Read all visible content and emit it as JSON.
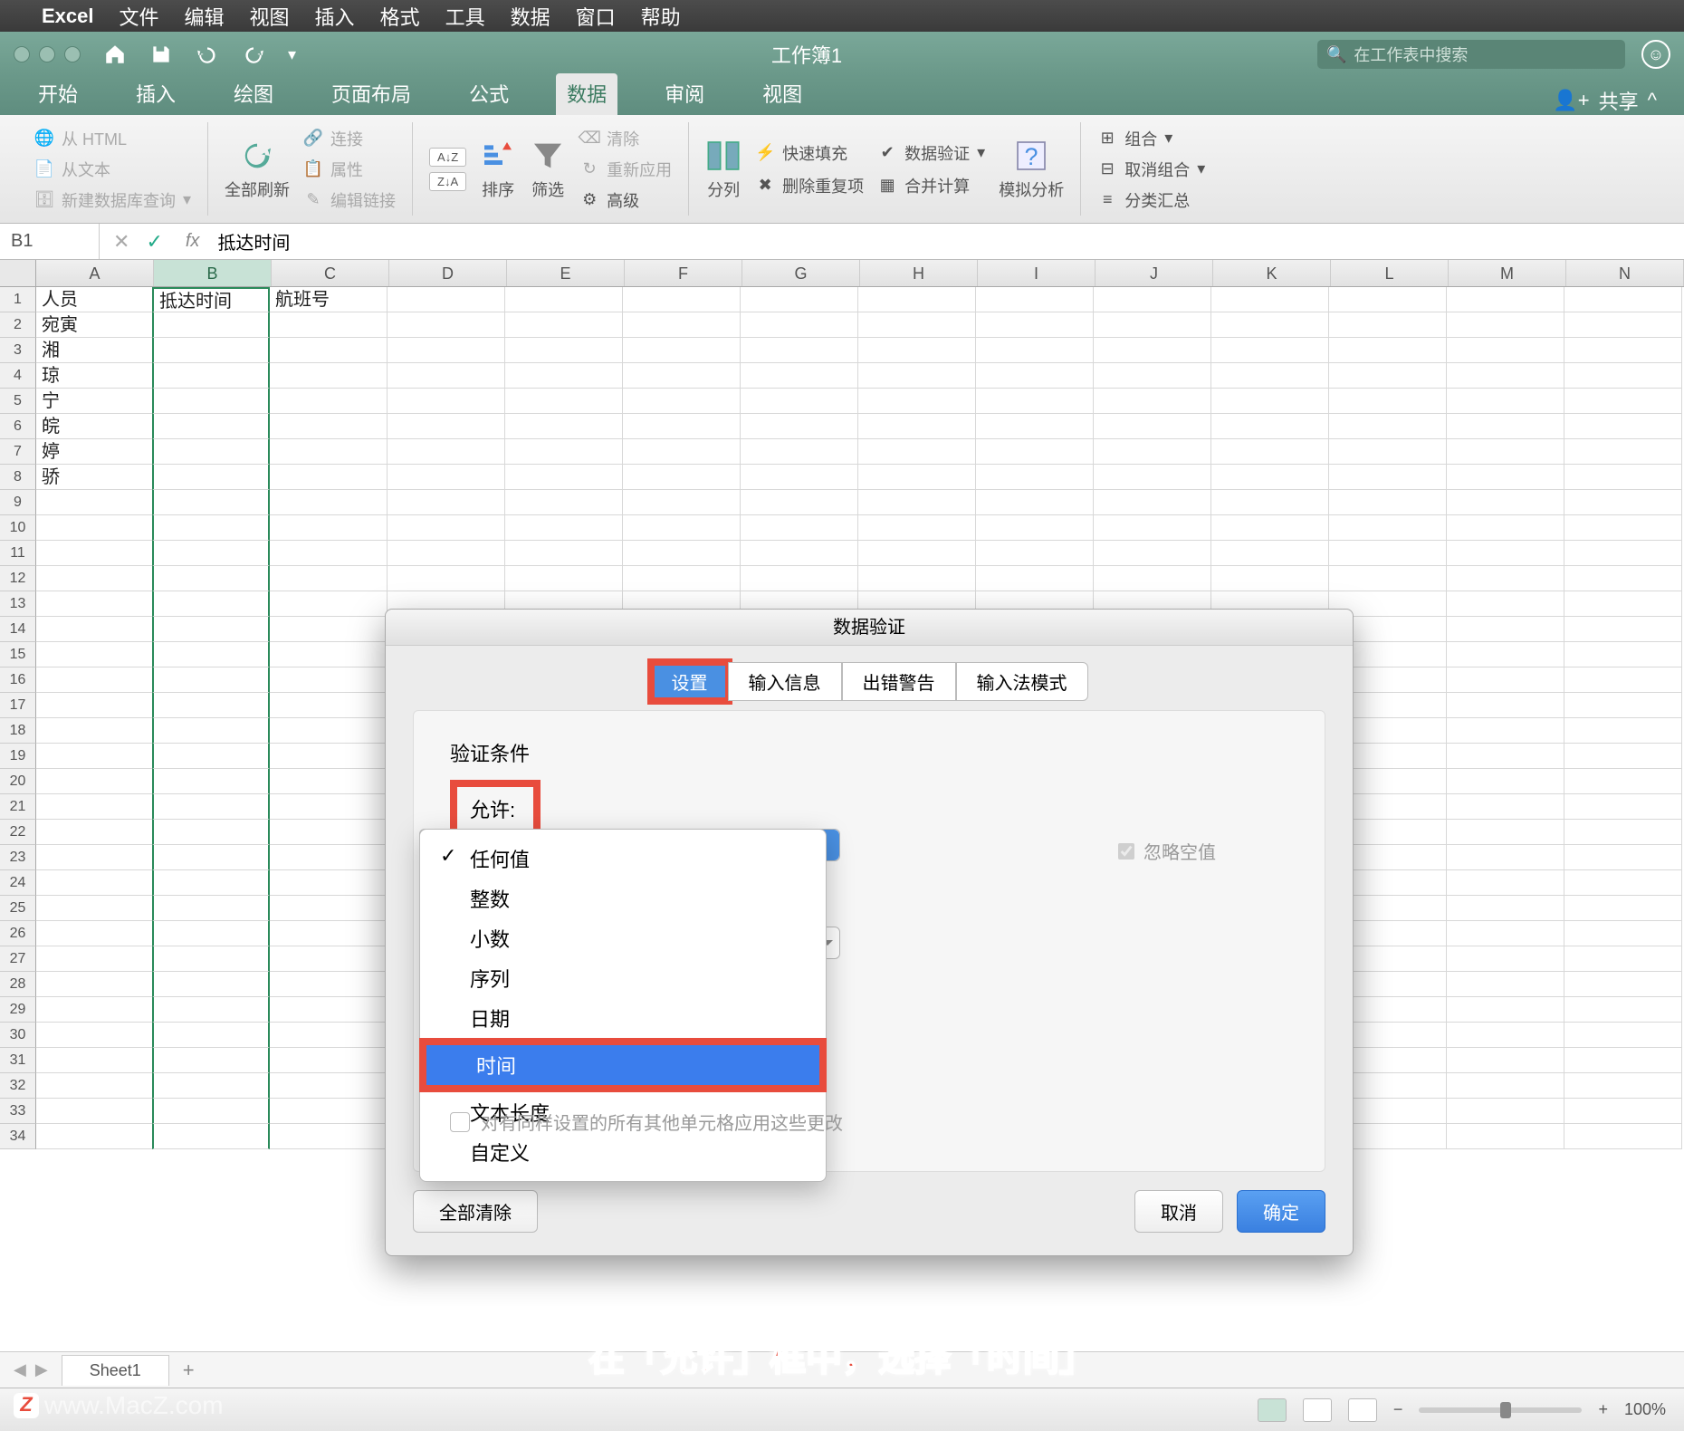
{
  "mac_menu": {
    "app": "Excel",
    "items": [
      "文件",
      "编辑",
      "视图",
      "插入",
      "格式",
      "工具",
      "数据",
      "窗口",
      "帮助"
    ]
  },
  "title_bar": {
    "title": "工作簿1",
    "search_placeholder": "在工作表中搜索"
  },
  "ribbon_tabs": {
    "tabs": [
      "开始",
      "插入",
      "绘图",
      "页面布局",
      "公式",
      "数据",
      "审阅",
      "视图"
    ],
    "active": "数据",
    "share": "共享"
  },
  "ribbon": {
    "get": {
      "html": "从 HTML",
      "text": "从文本",
      "newq": "新建数据库查询"
    },
    "refresh": {
      "all": "全部刷新",
      "conn": "连接",
      "prop": "属性",
      "edit": "编辑链接"
    },
    "sort": {
      "sort": "排序",
      "filter": "筛选",
      "clear": "清除",
      "reapply": "重新应用",
      "advanced": "高级"
    },
    "tools": {
      "split": "分列",
      "flash": "快速填充",
      "dedup": "删除重复项",
      "validate": "数据验证",
      "consolidate": "合并计算",
      "whatif": "模拟分析"
    },
    "outline": {
      "group": "组合",
      "ungroup": "取消组合",
      "subtotal": "分类汇总"
    }
  },
  "formula_bar": {
    "cell_ref": "B1",
    "formula": "抵达时间"
  },
  "grid": {
    "columns": [
      "A",
      "B",
      "C",
      "D",
      "E",
      "F",
      "G",
      "H",
      "I",
      "J",
      "K",
      "L",
      "M",
      "N"
    ],
    "selected_col": "B",
    "row_headers": [
      1,
      2,
      3,
      4,
      5,
      6,
      7,
      8,
      9,
      10,
      11,
      12,
      13,
      14,
      15,
      16,
      17,
      18,
      19,
      20,
      21,
      22,
      23,
      24,
      25,
      26,
      27,
      28,
      29,
      30,
      31,
      32,
      33,
      34
    ],
    "data": {
      "A": [
        "人员",
        "宛寅",
        "湘",
        "琼",
        "宁",
        "皖",
        "婷",
        "骄"
      ],
      "B": [
        "抵达时间"
      ],
      "C": [
        "航班号"
      ]
    }
  },
  "dialog": {
    "title": "数据验证",
    "tabs": [
      "设置",
      "输入信息",
      "出错警告",
      "输入法模式"
    ],
    "active_tab": "设置",
    "section": "验证条件",
    "allow_label": "允许:",
    "ignore_blank": "忽略空值",
    "apply_all": "对有同样设置的所有其他单元格应用这些更改",
    "dropdown": {
      "items": [
        "任何值",
        "整数",
        "小数",
        "序列",
        "日期",
        "时间",
        "文本长度",
        "自定义"
      ],
      "checked": "任何值",
      "selected": "时间"
    },
    "buttons": {
      "clear": "全部清除",
      "cancel": "取消",
      "ok": "确定"
    }
  },
  "sheet_tabs": {
    "active": "Sheet1"
  },
  "status_bar": {
    "zoom": "100%"
  },
  "caption": "在「允许」框中，选择「时间」",
  "watermark": "www.MacZ.com"
}
